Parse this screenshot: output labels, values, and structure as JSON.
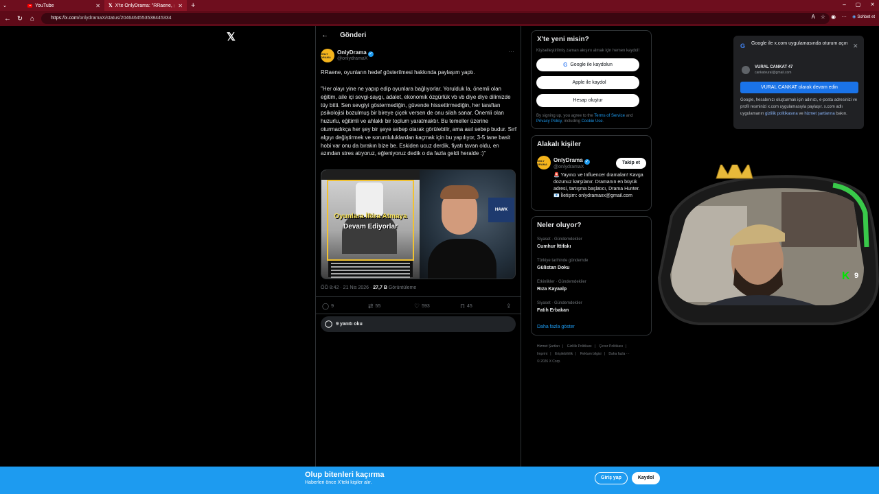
{
  "browser": {
    "tabs": [
      {
        "label": "YouTube",
        "icon": "youtube-icon"
      },
      {
        "label": "X'te OnlyDrama: \"RRaene, 🤖 da",
        "icon": "x-logo-icon"
      }
    ],
    "url_host": "https://x.com",
    "url_path": "/onlydramaX/status/2046464553538445334",
    "chat_label": "Sohbet et"
  },
  "header": {
    "title": "Gönderi"
  },
  "tweet": {
    "author_name": "OnlyDrama",
    "author_handle": "@onlydramaX",
    "avatar_text": "ONLY DRAMA",
    "lead": "RRaene, oyunların hedef gösterilmesi hakkında paylaşım yaptı.",
    "body": "\"Her olayı yine ne yapıp edip oyunlara bağlıyorlar. Yorulduk la, önemli olan eğitim, aile içi sevgi-saygı, adalet, ekonomik özgürlük vb vb diye diye dilimizde tüy bitti. Sen sevgiyi göstermediğin, güvende hissettirmediğin, her taraftan psikolojisi bozulmuş bir bireye çiçek versen de onu silah sanar. Önemli olan huzurlu, eğitimli ve ahlaklı bir toplum yaratmaktır. Bu temeller üzerine oturmadıkça her şey bir şeye sebep olarak görülebilir, ama asıl sebep budur. Sırf algıyı değiştirmek ve sorumluluklardan kaçmak için bu yapılıyor, 3-5 tane basit hobi var onu da bırakın bize be. Eskiden ucuz derdik, fiyatı tavan oldu, en azından stres atıyoruz, eğleniyoruz dedik o da fazla geldi heralde :)\"",
    "media_title_1": "Oyunlara İftira Atmaya",
    "media_title_2": "Devam Ediyorlar",
    "media_hawk": "HAWK",
    "time": "ÖÖ 8:42 · 21 Nis 2026 · ",
    "views": "27,7 B",
    "views_label": " Görüntüleme",
    "reply_count": "9",
    "repost_count": "55",
    "like_count": "593",
    "bookmark_count": "45",
    "read_replies": "9 yanıtı oku"
  },
  "signup_card": {
    "title": "X'te yeni misin?",
    "subtitle": "Kişiselleştirilmiş zaman akışını almak için hemen kaydol!",
    "google_btn": "Google ile kaydolun",
    "apple_btn": "Apple ile kaydol",
    "create_btn": "Hesap oluştur",
    "legal_1": "By signing up, you agree to the ",
    "terms": "Terms of Service",
    "legal_2": " and ",
    "privacy": "Privacy Policy",
    "legal_3": ", including ",
    "cookie": "Cookie Use",
    "legal_4": "."
  },
  "related_card": {
    "title": "Alakalı kişiler",
    "name": "OnlyDrama",
    "handle": "@onlydramaX",
    "follow": "Takip et",
    "bio": "🚨 Yayıncı ve Influencer dramaları! Kavga dozunuz karşılanır. Dramanın en büyük adresi, tartışma başlatıcı, Drama Hunter. 📧 İletişim: onlydramaxx@gmail.com"
  },
  "trends_card": {
    "title": "Neler oluyor?",
    "items": [
      {
        "category": "Siyaset · Gündemdekiler",
        "name": "Cumhur İttifakı"
      },
      {
        "category": "Türkiye tarihinde gündemde",
        "name": "Gülistan Doku"
      },
      {
        "category": "Etkinlikler · Gündemdekiler",
        "name": "Rıza Kayaalp"
      },
      {
        "category": "Siyaset · Gündemdekiler",
        "name": "Fatih Erbakan"
      }
    ],
    "show_more": "Daha fazla göster"
  },
  "footer": {
    "links": [
      "Hizmet Şartları",
      "|",
      "Gizlilik Politikası",
      "|",
      "Çerez Politikası",
      "|",
      "Imprint",
      "|",
      "Erişilebilirlik",
      "|",
      "Reklam bilgisi",
      "|",
      "Daha fazla ···"
    ],
    "copyright": "© 2026 X Corp."
  },
  "google_popup": {
    "title": "Google ile x.com uygulamasında oturum açın",
    "name": "VURAL CANKAT 47",
    "email": "cankatvural@gmail.com",
    "continue_btn": "VURAL CANKAT olarak devam edin",
    "legal_1": "Google, hesabınızı oluşturmak için adınızı, e-posta adresinizi ve profil resminizi x.com uygulamasıyla paylaşır. x.com adlı uygulamanın ",
    "privacy_link": "gizlilik politikasına",
    "legal_2": " ve ",
    "terms_link": "hizmet şartlarına",
    "legal_3": " bakın."
  },
  "overlay": {
    "k": "K",
    "number": "9"
  },
  "banner": {
    "title": "Olup bitenleri kaçırma",
    "subtitle": "Haberleri önce X'teki kişiler alır.",
    "login": "Giriş yap",
    "signup": "Kaydol"
  },
  "colors": {
    "accent": "#1d9bf0",
    "browser": "#6e0e1e",
    "google_blue": "#1a73e8",
    "kick_green": "#00e701"
  }
}
